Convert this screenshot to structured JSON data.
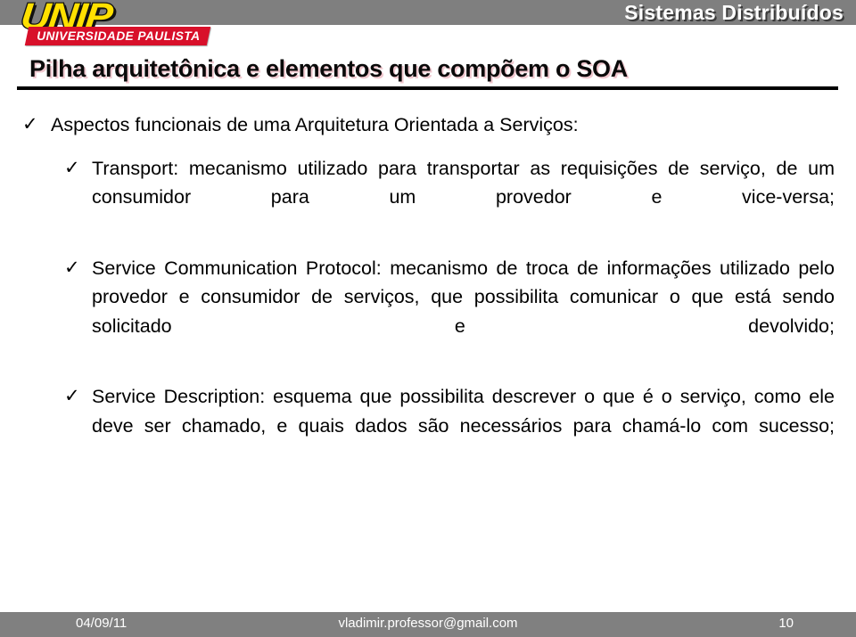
{
  "header": {
    "course_title": "Sistemas Distribuídos",
    "band_color": "#7f7f7f",
    "logo": {
      "wordmark": "UNIP",
      "tagline": "UNIVERSIDADE PAULISTA",
      "wordmark_color": "#ffe000",
      "tagline_band_color": "#d8102a"
    }
  },
  "slide": {
    "title": "Pilha arquitetônica e elementos que compõem o SOA",
    "bullets": [
      {
        "level": 1,
        "marker": "check-icon",
        "text": "Aspectos funcionais de uma Arquitetura Orientada a Serviços:"
      },
      {
        "level": 2,
        "marker": "check-icon",
        "text": "Transport: mecanismo utilizado para transportar as requisições de serviço, de um consumidor para um provedor e vice-versa;"
      },
      {
        "level": 2,
        "marker": "check-icon",
        "text": "Service Communication Protocol: mecanismo de troca de informações utilizado pelo provedor e consumidor de serviços, que possibilita comunicar o que está sendo solicitado e devolvido;"
      },
      {
        "level": 2,
        "marker": "check-icon",
        "text": "Service Description: esquema que possibilita descrever o que é o serviço, como ele deve ser chamado, e quais dados são necessários para chamá-lo com sucesso;"
      }
    ]
  },
  "footer": {
    "date": "04/09/11",
    "email": "vladimir.professor@gmail.com",
    "page_number": "10",
    "band_color": "#808080"
  },
  "icons": {
    "check": "✓"
  }
}
